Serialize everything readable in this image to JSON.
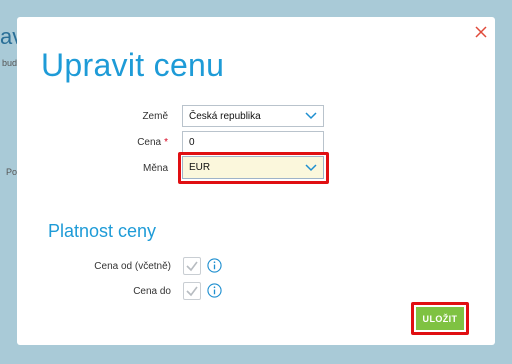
{
  "background": {
    "title_fragment": "av",
    "fragment_1": "bud",
    "fragment_2": "Po"
  },
  "modal": {
    "title": "Upravit cenu",
    "close_icon": "close-icon",
    "fields": {
      "zeme": {
        "label": "Země",
        "value": "Česká republika"
      },
      "cena": {
        "label": "Cena",
        "required_mark": "*",
        "value": "0"
      },
      "mena": {
        "label": "Měna",
        "value": "EUR"
      }
    },
    "validity": {
      "title": "Platnost ceny",
      "from_label": "Cena od (včetně)",
      "to_label": "Cena do"
    },
    "save_label": "ULOŽIT"
  },
  "colors": {
    "accent": "#1e9bd7",
    "save": "#7fc242",
    "highlight_frame": "#e00f12"
  }
}
